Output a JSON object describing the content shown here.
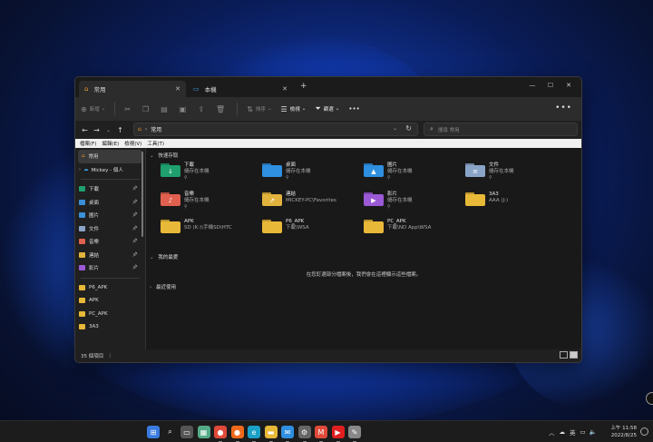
{
  "window": {
    "tabs": [
      {
        "label": "常用",
        "icon": "home-icon",
        "active": true
      },
      {
        "label": "本機",
        "icon": "computer-icon",
        "active": false
      }
    ],
    "new_tab": "+",
    "controls": {
      "minimize": "—",
      "maximize": "☐",
      "close": "✕"
    }
  },
  "toolbar": {
    "new_label": "新增",
    "sort_label": "排序",
    "view_label": "檢視",
    "filter_label": "篩選",
    "more": "•••"
  },
  "address": {
    "path": "常用",
    "search_placeholder": "搜尋 常用"
  },
  "menubar": [
    "檔案(F)",
    "編輯(E)",
    "檢視(V)",
    "工具(T)"
  ],
  "sidebar": {
    "home": "常用",
    "onedrive": "Mickey - 個人",
    "pinned": [
      {
        "label": "下載",
        "icon": "download-icon",
        "color": "#1f9e6e"
      },
      {
        "label": "桌面",
        "icon": "desktop-icon",
        "color": "#3a8fd9"
      },
      {
        "label": "圖片",
        "icon": "pictures-icon",
        "color": "#3a8fd9"
      },
      {
        "label": "文件",
        "icon": "documents-icon",
        "color": "#8aa4c8"
      },
      {
        "label": "音樂",
        "icon": "music-icon",
        "color": "#e0604f"
      },
      {
        "label": "連結",
        "icon": "links-icon",
        "color": "#e2b33c"
      },
      {
        "label": "影片",
        "icon": "videos-icon",
        "color": "#9b59d6"
      }
    ],
    "folders": [
      "P6_APK",
      "APK",
      "PC_APK",
      "3A3"
    ]
  },
  "main": {
    "quick_access_title": "快速存取",
    "quick_access": [
      {
        "name": "下載",
        "sub": "儲存在本機",
        "pinned": true,
        "icon": "download-folder-icon",
        "color": "#1f9e6e",
        "glyph": "↓"
      },
      {
        "name": "桌面",
        "sub": "儲存在本機",
        "pinned": true,
        "icon": "desktop-folder-icon",
        "color": "#2f8fe0",
        "glyph": ""
      },
      {
        "name": "圖片",
        "sub": "儲存在本機",
        "pinned": true,
        "icon": "pictures-folder-icon",
        "color": "#2f8fe0",
        "glyph": "▲"
      },
      {
        "name": "文件",
        "sub": "儲存在本機",
        "pinned": true,
        "icon": "documents-folder-icon",
        "color": "#8aa4c8",
        "glyph": "≡"
      },
      {
        "name": "音樂",
        "sub": "儲存在本機",
        "pinned": true,
        "icon": "music-folder-icon",
        "color": "#e0604f",
        "glyph": "♪"
      },
      {
        "name": "連結",
        "sub": "MICKEY-PC\\Favorites",
        "pinned": false,
        "icon": "links-folder-icon",
        "color": "#e2b33c",
        "glyph": "⇗"
      },
      {
        "name": "影片",
        "sub": "儲存在本機",
        "pinned": true,
        "icon": "videos-folder-icon",
        "color": "#9b59d6",
        "glyph": "▶"
      },
      {
        "name": "3A3",
        "sub": "AAA (J:)",
        "pinned": false,
        "icon": "folder-icon",
        "color": "#e8b838",
        "glyph": ""
      },
      {
        "name": "APK",
        "sub": "SD (K:)\\手機SD\\HTC",
        "pinned": false,
        "icon": "folder-icon",
        "color": "#e8b838",
        "glyph": ""
      },
      {
        "name": "P6_APK",
        "sub": "下載\\WSA",
        "pinned": false,
        "icon": "folder-icon",
        "color": "#e8b838",
        "glyph": ""
      },
      {
        "name": "PC_APK",
        "sub": "下載\\ND App\\WSA",
        "pinned": false,
        "icon": "folder-icon",
        "color": "#e8b838",
        "glyph": ""
      }
    ],
    "favorites_title": "我的最愛",
    "favorites_empty": "在您釘選部分檔案後，我們會在這裡顯示這些檔案。",
    "recent_title": "最近使用"
  },
  "status": {
    "count": "35 個項目",
    "separator": "|"
  },
  "taskbar": {
    "time": "上午 11:58",
    "date": "2022/8/25",
    "ime": "英",
    "apps": [
      {
        "name": "start",
        "color": "#3a7be0",
        "glyph": "⊞"
      },
      {
        "name": "search",
        "color": "transparent",
        "glyph": "⌕"
      },
      {
        "name": "task-view",
        "color": "#555",
        "glyph": "▭"
      },
      {
        "name": "widgets",
        "color": "#5a8",
        "glyph": "▦"
      },
      {
        "name": "chrome",
        "color": "#e04a3a",
        "glyph": "●"
      },
      {
        "name": "firefox",
        "color": "#f06a1c",
        "glyph": "●"
      },
      {
        "name": "edge",
        "color": "#1ba0c8",
        "glyph": "e"
      },
      {
        "name": "file-explorer",
        "color": "#e8b838",
        "glyph": "▬"
      },
      {
        "name": "mail",
        "color": "#2f8fe0",
        "glyph": "✉"
      },
      {
        "name": "settings",
        "color": "#666",
        "glyph": "⚙"
      },
      {
        "name": "gmail",
        "color": "#e04a3a",
        "glyph": "M"
      },
      {
        "name": "youtube",
        "color": "#e02020",
        "glyph": "▶"
      },
      {
        "name": "paint",
        "color": "#888",
        "glyph": "✎"
      }
    ]
  }
}
